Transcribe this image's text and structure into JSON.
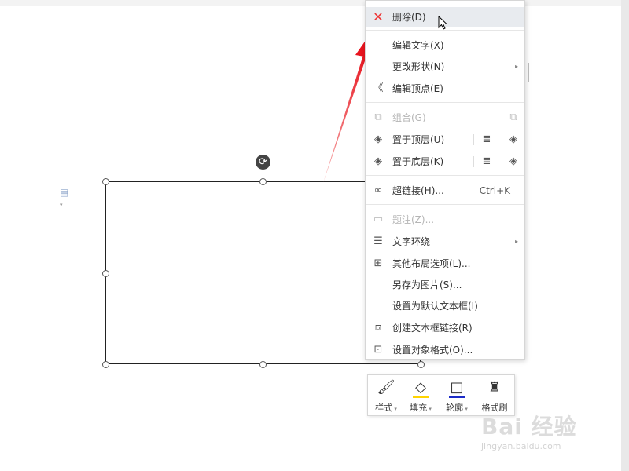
{
  "context_menu": {
    "items": [
      {
        "label": "删除(D)",
        "icon": "close-icon",
        "highlighted": true
      },
      {
        "label": "编辑文字(X)"
      },
      {
        "label": "更改形状(N)",
        "submenu": true
      },
      {
        "label": "编辑顶点(E)",
        "icon": "edit-points-icon"
      },
      {
        "label": "组合(G)",
        "icon": "group-icon",
        "disabled": true
      },
      {
        "label": "置于顶层(U)",
        "icon": "bring-to-front-icon"
      },
      {
        "label": "置于底层(K)",
        "icon": "send-to-back-icon"
      },
      {
        "label": "超链接(H)...",
        "icon": "hyperlink-icon",
        "shortcut": "Ctrl+K"
      },
      {
        "label": "题注(Z)...",
        "icon": "caption-icon",
        "disabled": true
      },
      {
        "label": "文字环绕",
        "icon": "text-wrap-icon",
        "submenu": true
      },
      {
        "label": "其他布局选项(L)...",
        "icon": "layout-options-icon"
      },
      {
        "label": "另存为图片(S)..."
      },
      {
        "label": "设置为默认文本框(I)"
      },
      {
        "label": "创建文本框链接(R)",
        "icon": "textbox-link-icon"
      },
      {
        "label": "设置对象格式(O)...",
        "icon": "format-object-icon"
      }
    ]
  },
  "mini_toolbar": {
    "style_label": "样式",
    "fill_label": "填充",
    "outline_label": "轮廓",
    "format_painter_label": "格式刷",
    "fill_color": "#ffd400",
    "outline_color": "#1c2cc8"
  },
  "watermark": {
    "brand": "Bai 经验",
    "url": "jingyan.baidu.com"
  },
  "colors": {
    "annotation_arrow": "#e8141e",
    "menu_highlight": "#e8ebef"
  }
}
